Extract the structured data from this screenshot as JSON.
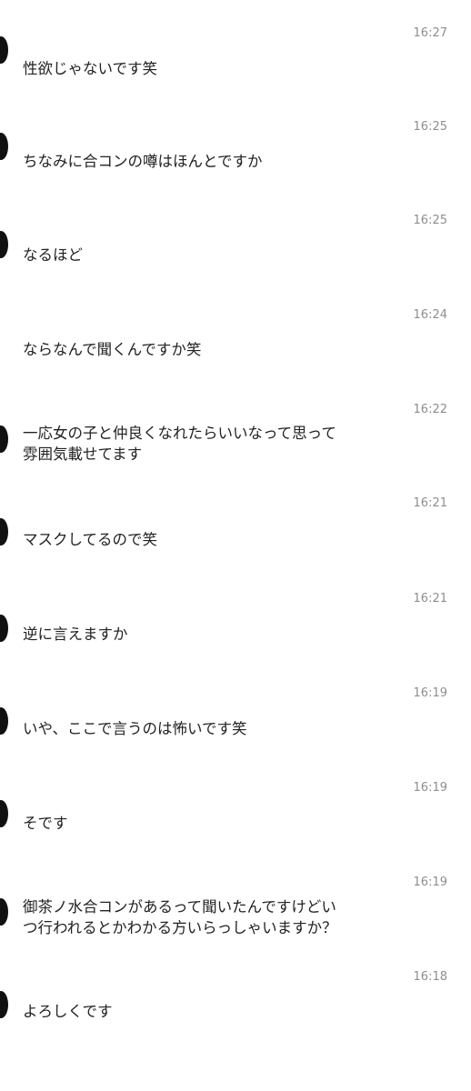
{
  "messages": [
    {
      "time": "16:27",
      "text": "性欲じゃないです笑"
    },
    {
      "time": "16:25",
      "text": "ちなみに合コンの噂はほんとですか"
    },
    {
      "time": "16:25",
      "text": "なるほど"
    },
    {
      "time": "16:24",
      "text": "ならなんで聞くんですか笑"
    },
    {
      "time": "16:22",
      "text": "一応女の子と仲良くなれたらいいなって思って\n雰囲気載せてます"
    },
    {
      "time": "16:21",
      "text": "マスクしてるので笑"
    },
    {
      "time": "16:21",
      "text": "逆に言えますか"
    },
    {
      "time": "16:19",
      "text": "いや、ここで言うのは怖いです笑"
    },
    {
      "time": "16:19",
      "text": "そです"
    },
    {
      "time": "16:19",
      "text": "御茶ノ水合コンがあるって聞いたんですけどい\nつ行われるとかわかる方いらっしゃいますか？"
    },
    {
      "time": "16:18",
      "text": "よろしくです"
    }
  ],
  "colors": {
    "background": "#ffffff",
    "timestamp": "#8e8e8e",
    "message_text": "#222222",
    "avatar": "#111111"
  }
}
